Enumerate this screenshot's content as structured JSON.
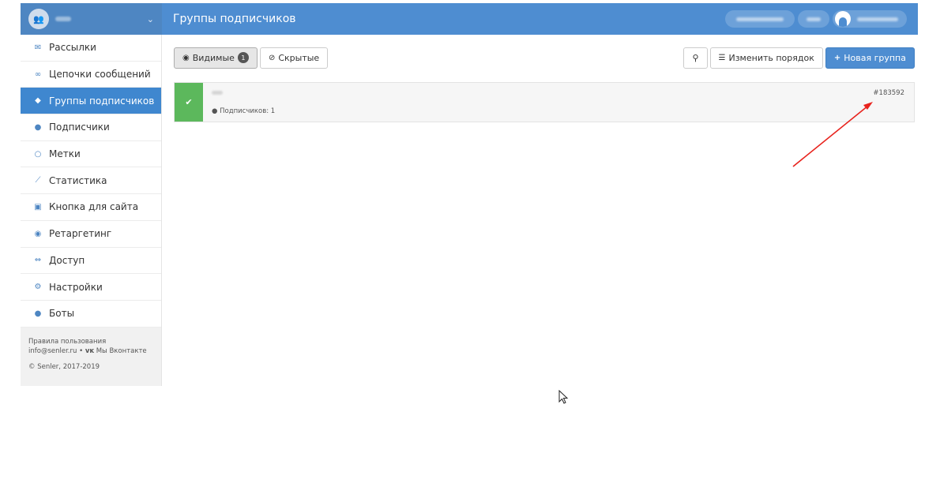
{
  "topbar": {
    "header_title": "Группы подписчиков",
    "brand_color": "#4e86c2",
    "header_color": "#4e8dd1"
  },
  "sidebar": {
    "items": [
      {
        "label": "Рассылки",
        "icon": "envelope-icon",
        "glyph": "✉"
      },
      {
        "label": "Цепочки сообщений",
        "icon": "link-icon",
        "glyph": "∞"
      },
      {
        "label": "Группы подписчиков",
        "icon": "tags-icon",
        "glyph": "◆",
        "active": true
      },
      {
        "label": "Подписчики",
        "icon": "users-icon",
        "glyph": "●"
      },
      {
        "label": "Метки",
        "icon": "circle-icon",
        "glyph": "○"
      },
      {
        "label": "Статистика",
        "icon": "chart-line-icon",
        "glyph": "⟋"
      },
      {
        "label": "Кнопка для сайта",
        "icon": "code-file-icon",
        "glyph": "▣"
      },
      {
        "label": "Ретаргетинг",
        "icon": "target-icon",
        "glyph": "◉"
      },
      {
        "label": "Доступ",
        "icon": "handshake-icon",
        "glyph": "⇔"
      },
      {
        "label": "Настройки",
        "icon": "gears-icon",
        "glyph": "⚙"
      },
      {
        "label": "Боты",
        "icon": "android-icon",
        "glyph": "●"
      }
    ],
    "footer": {
      "terms": "Правила пользования",
      "email": "info@senler.ru",
      "separator": "•",
      "vk_label": "Мы Вконтакте",
      "copyright": "© Senler, 2017-2019"
    }
  },
  "toolbar": {
    "visible_label": "Видимые",
    "visible_count": "1",
    "hidden_label": "Скрытые",
    "reorder_label": "Изменить порядок",
    "new_group_label": "Новая группа"
  },
  "groups": [
    {
      "subscribers": "Подписчиков: 1",
      "id": "#183592",
      "status_color": "#5cb85c"
    }
  ]
}
